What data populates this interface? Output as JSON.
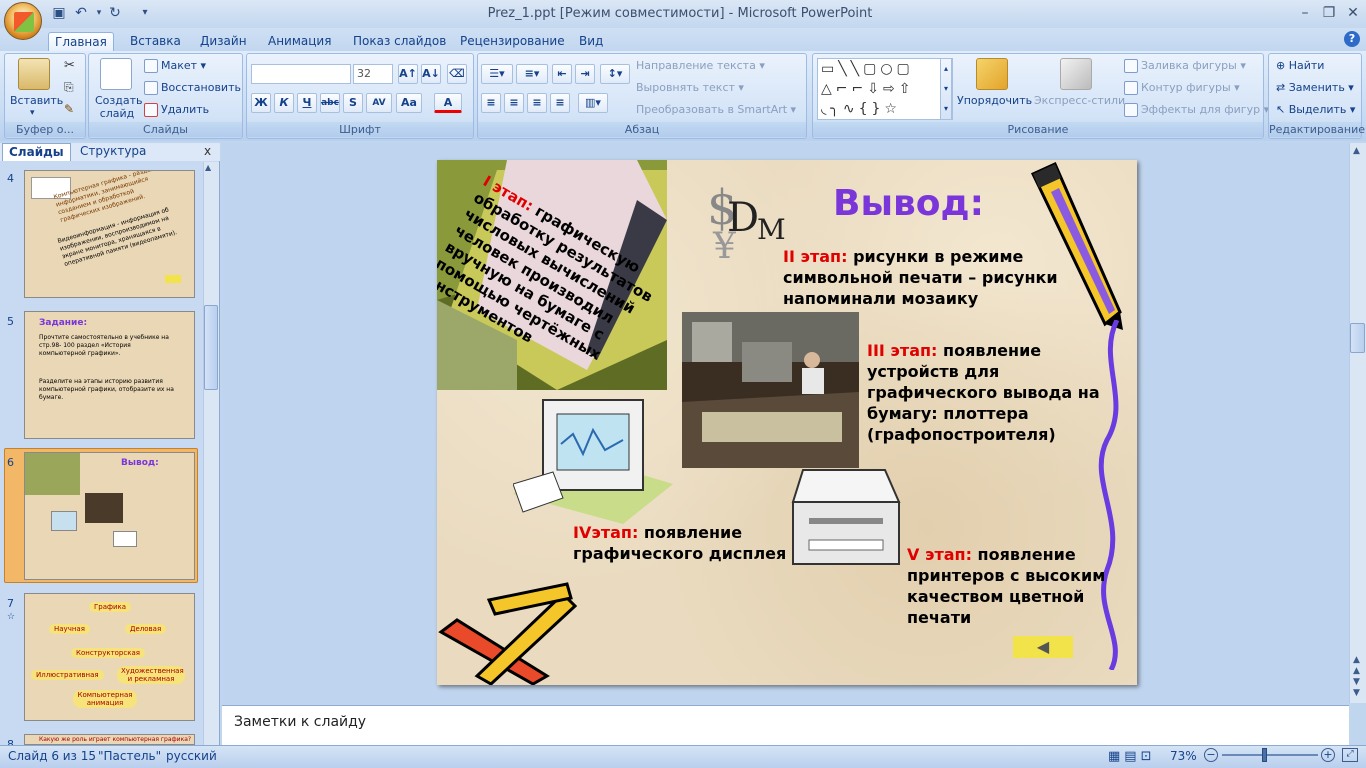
{
  "window": {
    "title": "Prez_1.ppt [Режим совместимости] - Microsoft PowerPoint",
    "min_icon": "minimize-icon",
    "max_icon": "restore-icon",
    "close_icon": "close-icon"
  },
  "ribbon_tabs": [
    "Главная",
    "Вставка",
    "Дизайн",
    "Анимация",
    "Показ слайдов",
    "Рецензирование",
    "Вид"
  ],
  "clipboard": {
    "paste": "Вставить",
    "label": "Буфер о..."
  },
  "slides_group": {
    "new_slide": "Создать слайд",
    "layout": "Макет",
    "reset": "Восстановить",
    "delete": "Удалить",
    "label": "Слайды"
  },
  "font_group": {
    "font_name": "",
    "font_size": "32",
    "label": "Шрифт",
    "bold": "Ж",
    "italic": "К",
    "underline": "Ч",
    "strike": "abc",
    "shadow": "S",
    "spacing": "AV",
    "case": "Aa",
    "color": "A"
  },
  "paragraph_group": {
    "text_direction": "Направление текста",
    "align_text": "Выровнять текст",
    "smartart": "Преобразовать в SmartArt",
    "label": "Абзац"
  },
  "drawing_group": {
    "arrange": "Упорядочить",
    "quick_styles": "Экспресс-стили",
    "shape_fill": "Заливка фигуры",
    "shape_outline": "Контур фигуры",
    "shape_effects": "Эффекты для фигур",
    "label": "Рисование"
  },
  "editing_group": {
    "find": "Найти",
    "replace": "Заменить",
    "select": "Выделить",
    "label": "Редактирование"
  },
  "panel": {
    "tab_slides": "Слайды",
    "tab_outline": "Структура",
    "close": "x"
  },
  "thumbnails": [
    {
      "num": "4",
      "lines": [
        "Компьютерная графика - раздел информатики, занимающийся созданием и обработкой графических изображений.",
        "Видеоинформация - информация об изображении, воспроизводимом на экране монитора, хранящаяся в оперативной памяти (видеопамяти)."
      ]
    },
    {
      "num": "5",
      "title": "Задание:",
      "lines": [
        "Прочтите самостоятельно в учебнике на стр.98- 100 раздел «История компьютерной графики».",
        "Разделите на этапы историю развития компьютерной графики, отобразите их на бумаге."
      ]
    },
    {
      "num": "6",
      "title": "Вывод:"
    },
    {
      "num": "7",
      "labels": [
        "Графика",
        "Научная",
        "Деловая",
        "Конструкторская",
        "Иллюстративная",
        "Художественная и рекламная",
        "Компьютерная анимация"
      ]
    },
    {
      "num": "8",
      "lines": [
        "Какую же роль играет компьютерная графика?"
      ]
    }
  ],
  "slide": {
    "title": "Вывод:",
    "stage1_label": "I этап:",
    "stage1_text": "графическую обработку результатов числовых вычислений человек производил вручную на бумаге с помощью чертёжных инструментов",
    "stage2_label": "II этап:",
    "stage2_text": "рисунки в режиме символьной печати – рисунки напоминали мозаику",
    "stage3_label": "III этап:",
    "stage3_text": "появление устройств для графического вывода на бумагу: плоттера (графопостроителя)",
    "stage4_label": "IVэтап:",
    "stage4_text": "появление графического дисплея",
    "stage5_label": "V этап:",
    "stage5_text": "появление принтеров с высоким качеством цветной печати"
  },
  "notes": {
    "placeholder": "Заметки к слайду"
  },
  "status": {
    "slide_info": "Слайд 6 из 15",
    "theme": "\"Пастель\"",
    "language": "русский",
    "zoom": "73%"
  }
}
